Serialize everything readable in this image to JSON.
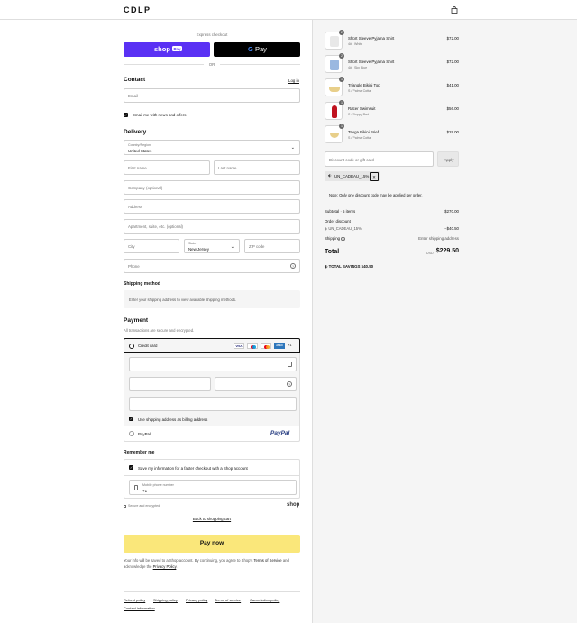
{
  "header": {
    "logo": "CDLP",
    "bag_icon": "shopping-bag-icon"
  },
  "express": {
    "title": "Express checkout",
    "shop_pay_label": "shop",
    "shop_pay_badge": "Pay",
    "gpay_label": "Pay",
    "divider": "OR"
  },
  "contact": {
    "title": "Contact",
    "login": "Log in",
    "email_placeholder": "Email",
    "news_label": "Email me with news and offers"
  },
  "delivery": {
    "title": "Delivery",
    "country_label": "Country/Region",
    "country_value": "United States",
    "first_name": "First name",
    "last_name": "Last name",
    "company": "Company (optional)",
    "address": "Address",
    "apartment": "Apartment, suite, etc. (optional)",
    "city": "City",
    "state_label": "State",
    "state_value": "New Jersey",
    "zip": "ZIP code",
    "phone": "Phone"
  },
  "shipping": {
    "title": "Shipping method",
    "message": "Enter your shipping address to view available shipping methods."
  },
  "payment": {
    "title": "Payment",
    "subtitle": "All transactions are secure and encrypted.",
    "credit_card": "Credit card",
    "card_brands": [
      "VISA",
      "MC",
      "MC",
      "AMEX"
    ],
    "more_brands": "+1",
    "billing_same": "Use shipping address as billing address",
    "paypal": "PayPal",
    "paypal_logo": "PayPal"
  },
  "remember": {
    "title": "Remember me",
    "save_label": "Save my information for a faster checkout with a Shop account",
    "phone_label": "Mobile phone number",
    "phone_value": "+1",
    "secure": "Secure and encrypted",
    "shop_logo": "shop"
  },
  "actions": {
    "back": "Back to shopping cart",
    "pay_now": "Pay now"
  },
  "legal": {
    "prefix": "Your info will be saved to a Shop account. By continuing, you agree to Shop's",
    "terms": "Terms of Service",
    "middle": "and acknowledge the",
    "privacy": "Privacy Policy",
    "suffix": "."
  },
  "footer": {
    "links": [
      "Refund policy",
      "Shipping policy",
      "Privacy policy",
      "Terms of service",
      "Cancellation policy",
      "Contact information"
    ]
  },
  "cart": {
    "items": [
      {
        "qty": "2",
        "name": "Short Sleeve Pyjama Shirt",
        "variant": "4# / White",
        "price": "$72.00",
        "color": "#e8e8e8"
      },
      {
        "qty": "2",
        "name": "Short Sleeve Pyjama Shirt",
        "variant": "4# / Sky Blue",
        "price": "$72.00",
        "color": "#9ab8e0"
      },
      {
        "qty": "1",
        "name": "Triangle Bikini Top",
        "variant": "S / Palma Cotta",
        "price": "$41.00",
        "color": "#e8cf8a"
      },
      {
        "qty": "1",
        "name": "Racer Swimsuit",
        "variant": "S / Poppy Red",
        "price": "$56.00",
        "color": "#c0121f"
      },
      {
        "qty": "1",
        "name": "Tanga Bikini Brief",
        "variant": "S / Palma Cotta",
        "price": "$29.00",
        "color": "#e8cf8a"
      }
    ],
    "discount_placeholder": "Discount code or gift card",
    "apply": "Apply",
    "code_tag": "UN_CADEAU_15%",
    "note": "Note: Only one discount code may be applied per order.",
    "subtotal_label": "Subtotal · 5 items",
    "subtotal_value": "$270.00",
    "order_discount_label": "Order discount",
    "discount_code": "UN_CADEAU_15%",
    "discount_value": "−$40.50",
    "shipping_label": "Shipping",
    "shipping_value": "Enter shipping address",
    "total_label": "Total",
    "currency": "USD",
    "total_value": "$229.50",
    "savings_label": "TOTAL SAVINGS",
    "savings_value": "$40.50"
  }
}
